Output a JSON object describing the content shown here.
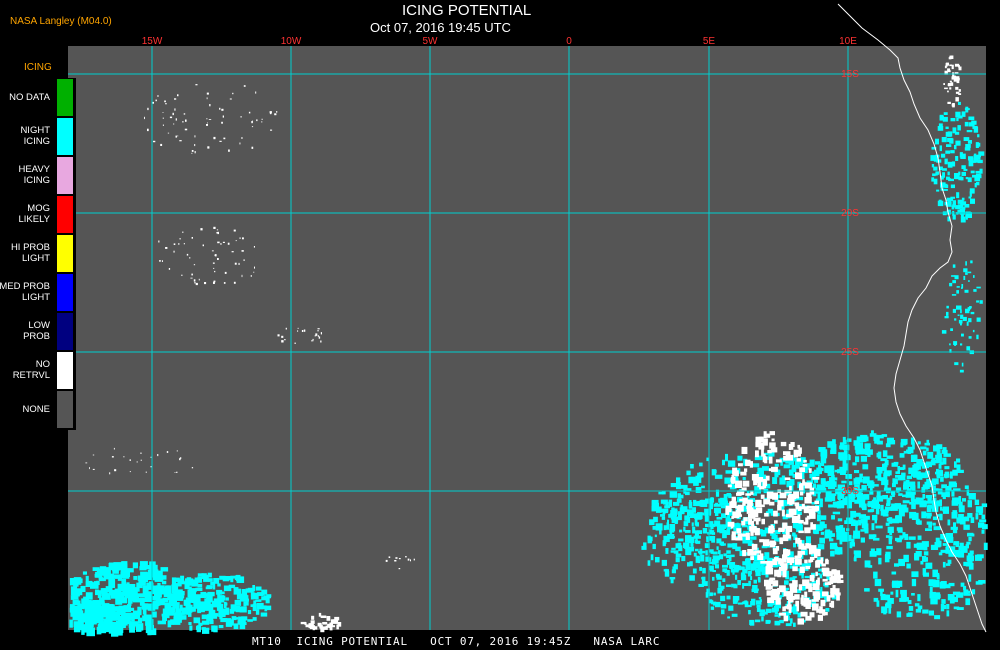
{
  "header": {
    "producer": "NASA Langley (M04.0)",
    "title": "ICING POTENTIAL",
    "subtitle": "Oct 07, 2016 19:45 UTC"
  },
  "footer": {
    "text": "MT10  ICING POTENTIAL   OCT 07, 2016 19:45Z   NASA LARC"
  },
  "legend": {
    "title": "ICING",
    "items": [
      {
        "label": "NO DATA",
        "color": "#00b000"
      },
      {
        "label": "NIGHT\nICING",
        "color": "#00ffff"
      },
      {
        "label": "HEAVY\nICING",
        "color": "#e8a8e0"
      },
      {
        "label": "MOG\nLIKELY",
        "color": "#ff0000"
      },
      {
        "label": "HI PROB\nLIGHT",
        "color": "#ffff00"
      },
      {
        "label": "MED PROB\nLIGHT",
        "color": "#0000ff"
      },
      {
        "label": "LOW\nPROB",
        "color": "#000080"
      },
      {
        "label": "NO\nRETRVL",
        "color": "#ffffff"
      },
      {
        "label": "NONE",
        "color": "#555555"
      }
    ]
  },
  "map": {
    "background": "#555555",
    "gridline_color": "#00d0d0",
    "coast_color": "#ffffff",
    "icing_color": "#00ffff",
    "noretrieval_color": "#ffffff",
    "longitude_labels": [
      "15W",
      "10W",
      "5W",
      "0",
      "5E",
      "10E"
    ],
    "latitude_labels": [
      "15S",
      "20S",
      "25S",
      "30S"
    ]
  }
}
